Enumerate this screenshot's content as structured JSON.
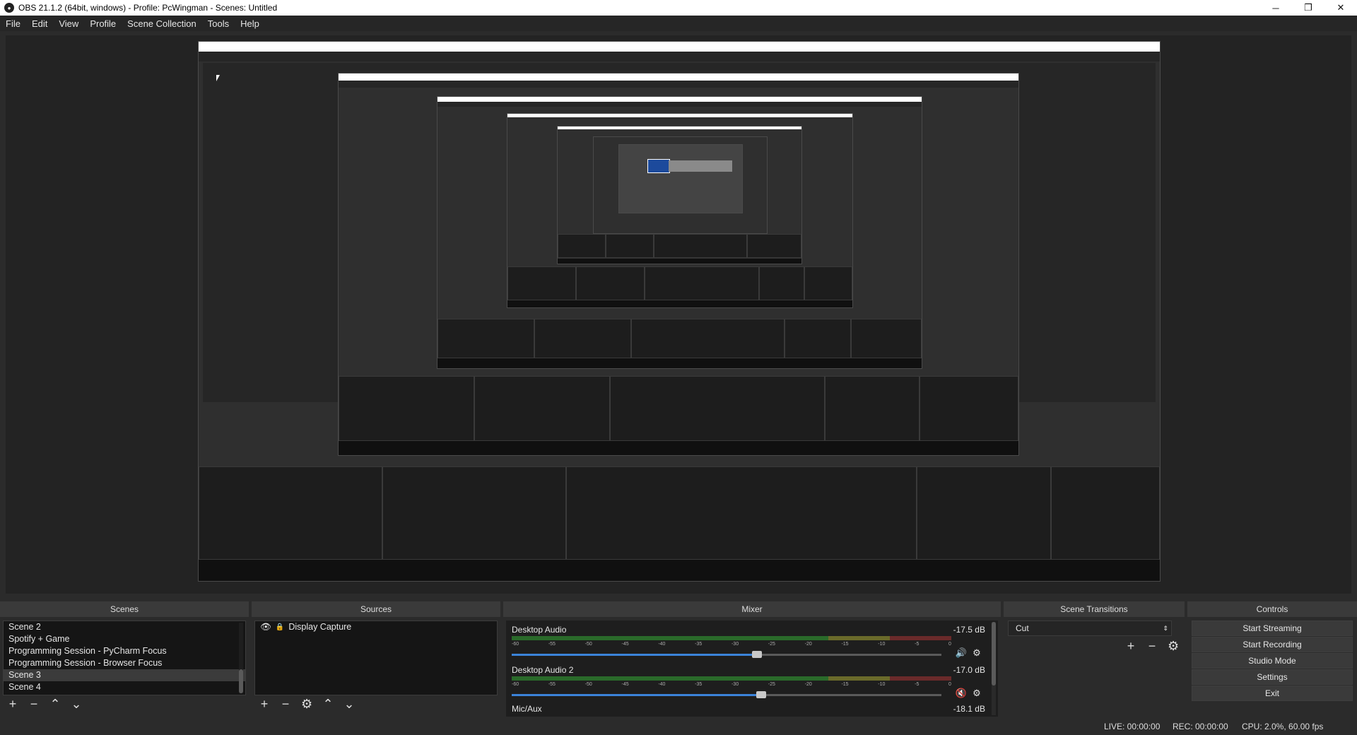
{
  "window": {
    "title": "OBS 21.1.2 (64bit, windows) - Profile: PcWingman - Scenes: Untitled",
    "minimize": "─",
    "restore": "❐",
    "close": "✕"
  },
  "menu": [
    "File",
    "Edit",
    "View",
    "Profile",
    "Scene Collection",
    "Tools",
    "Help"
  ],
  "docks": {
    "scenes": {
      "title": "Scenes",
      "items": [
        "Scene 2",
        "Spotify + Game",
        "Programming Session - PyCharm Focus",
        "Programming Session - Browser Focus",
        "Scene 3",
        "Scene 4"
      ],
      "selected_index": 4
    },
    "sources": {
      "title": "Sources",
      "items": [
        "Display Capture"
      ]
    },
    "mixer": {
      "title": "Mixer",
      "ticks": [
        "-60",
        "-55",
        "-50",
        "-45",
        "-40",
        "-35",
        "-30",
        "-25",
        "-20",
        "-15",
        "-10",
        "-5",
        "0"
      ],
      "channels": [
        {
          "name": "Desktop Audio",
          "db": "-17.5 dB",
          "fader": 0.57,
          "muted": false
        },
        {
          "name": "Desktop Audio 2",
          "db": "-17.0 dB",
          "fader": 0.58,
          "muted": true
        }
      ],
      "third_channel": {
        "name": "Mic/Aux",
        "db": "-18.1 dB"
      }
    },
    "transitions": {
      "title": "Scene Transitions",
      "selected": "Cut"
    },
    "controls": {
      "title": "Controls",
      "buttons": [
        "Start Streaming",
        "Start Recording",
        "Studio Mode",
        "Settings",
        "Exit"
      ]
    }
  },
  "status": {
    "live": "LIVE: 00:00:00",
    "rec": "REC: 00:00:00",
    "cpu": "CPU: 2.0%, 60.00 fps"
  },
  "colors": {
    "accent": "#3b83d9",
    "muted_icon": "#d9302b"
  }
}
